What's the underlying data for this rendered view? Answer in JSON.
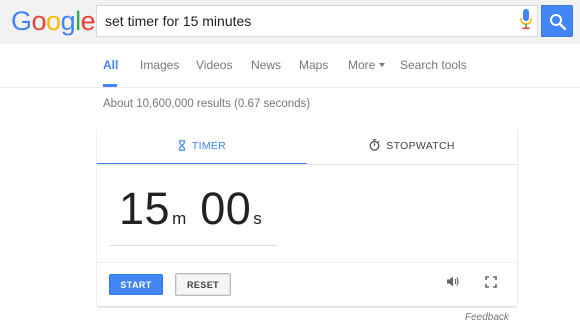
{
  "logo": {
    "letters": [
      "G",
      "o",
      "o",
      "g",
      "l",
      "e"
    ],
    "colors": [
      "#4285f4",
      "#ea4335",
      "#fbbc05",
      "#4285f4",
      "#34a853",
      "#ea4335"
    ]
  },
  "search": {
    "query": "set timer for 15 minutes",
    "mic_icon": "mic-icon",
    "button_icon": "search-icon"
  },
  "nav": {
    "items": [
      "All",
      "Images",
      "Videos",
      "News",
      "Maps",
      "More",
      "Search tools"
    ],
    "active": "All"
  },
  "results": {
    "stats": "About 10,600,000 results (0.67 seconds)"
  },
  "timer_card": {
    "tabs": [
      {
        "label": "TIMER",
        "icon": "hourglass-icon"
      },
      {
        "label": "STOPWATCH",
        "icon": "stopwatch-icon"
      }
    ],
    "active_tab": "TIMER",
    "minutes": "15",
    "minutes_unit": "m",
    "seconds": "00",
    "seconds_unit": "s",
    "start_label": "START",
    "reset_label": "RESET",
    "sound_icon": "speaker-icon",
    "fullscreen_icon": "fullscreen-icon"
  },
  "feedback": "Feedback",
  "colors": {
    "accent": "#4285f4",
    "text_muted": "#777777"
  }
}
